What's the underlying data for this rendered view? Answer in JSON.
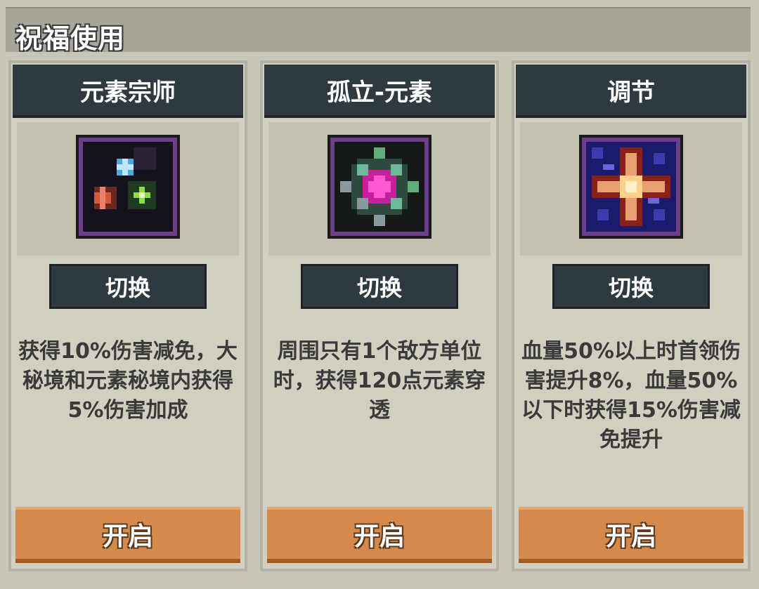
{
  "header": {
    "title": "祝福使用"
  },
  "cards": [
    {
      "name": "元素宗师",
      "icon": "elements-gems-icon",
      "switch_label": "切换",
      "description": "获得10%伤害减免，大秘境和元素秘境内获得5%伤害加成",
      "open_label": "开启"
    },
    {
      "name": "孤立-元素",
      "icon": "isolated-gem-icon",
      "switch_label": "切换",
      "description": "周围只有1个敌方单位时，获得120点元素穿透",
      "open_label": "开启"
    },
    {
      "name": "调节",
      "icon": "cross-star-icon",
      "switch_label": "切换",
      "description": "血量50%以上时首领伤害提升8%，血量50%以下时获得15%伤害减免提升",
      "open_label": "开启"
    }
  ],
  "colors": {
    "background": "#c9c6b8",
    "header_bar": "#a8a699",
    "card_header": "#2f3940",
    "open_button": "#d48a4c",
    "icon_frame": "#6b3f8a"
  }
}
